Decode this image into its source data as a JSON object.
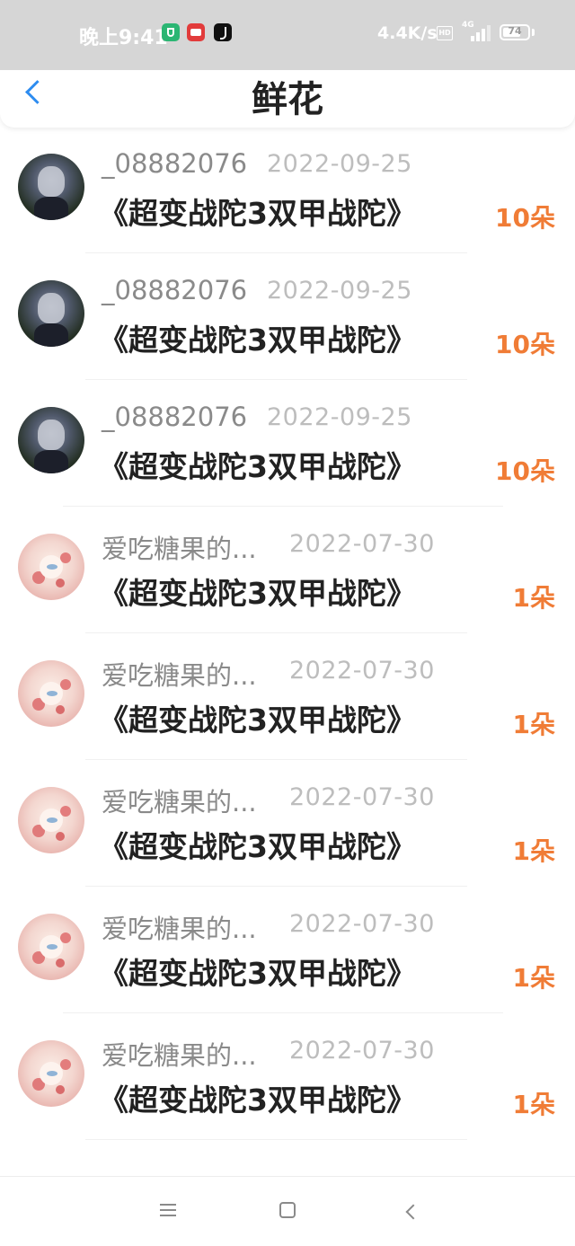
{
  "status_bar": {
    "time": "晚上9:41",
    "speed": "4.4K/s",
    "hd": "HD",
    "network": "4G",
    "battery": "74",
    "battery_level": 0.74,
    "app_icons": [
      "shield-icon",
      "news-app-icon",
      "tiktok-icon"
    ]
  },
  "header": {
    "title": "鲜花",
    "back_icon": "chevron-left-icon"
  },
  "list": [
    {
      "username": "",
      "date": "",
      "title": "《超变战陀3双甲战陀》",
      "count": "10朵",
      "avatar": "dark"
    },
    {
      "username": "_08882076",
      "date": "2022-09-25",
      "title": "《超变战陀3双甲战陀》",
      "count": "10朵",
      "avatar": "dark"
    },
    {
      "username": "_08882076",
      "date": "2022-09-25",
      "title": "《超变战陀3双甲战陀》",
      "count": "10朵",
      "avatar": "dark"
    },
    {
      "username": "_08882076",
      "date": "2022-09-25",
      "title": "《超变战陀3双甲战陀》",
      "count": "10朵",
      "avatar": "dark"
    },
    {
      "username": "爱吃糖果的...",
      "date": "2022-07-30",
      "title": "《超变战陀3双甲战陀》",
      "count": "1朵",
      "avatar": "pink"
    },
    {
      "username": "爱吃糖果的...",
      "date": "2022-07-30",
      "title": "《超变战陀3双甲战陀》",
      "count": "1朵",
      "avatar": "pink"
    },
    {
      "username": "爱吃糖果的...",
      "date": "2022-07-30",
      "title": "《超变战陀3双甲战陀》",
      "count": "1朵",
      "avatar": "pink"
    },
    {
      "username": "爱吃糖果的...",
      "date": "2022-07-30",
      "title": "《超变战陀3双甲战陀》",
      "count": "1朵",
      "avatar": "pink"
    },
    {
      "username": "爱吃糖果的...",
      "date": "2022-07-30",
      "title": "《超变战陀3双甲战陀》",
      "count": "1朵",
      "avatar": "pink"
    }
  ],
  "nav_bar": {
    "icons": [
      "menu-icon",
      "home-square-icon",
      "back-arrow-icon"
    ]
  },
  "colors": {
    "accent": "#2d8cf0",
    "count": "#f07c36",
    "status_bar_bg": "#d6d6d6"
  }
}
